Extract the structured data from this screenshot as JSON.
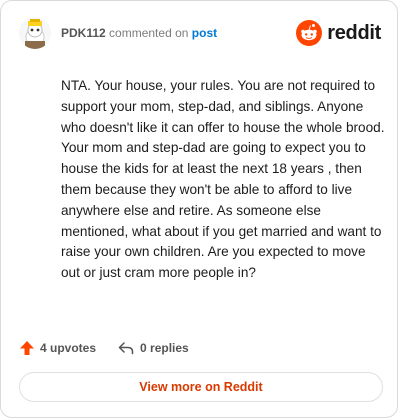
{
  "header": {
    "username": "PDK112",
    "action_text": "commented on",
    "post_link": "post",
    "brand_wordmark": "reddit",
    "avatar_icon": "avatar-icon",
    "logo_icon": "reddit-alien-icon"
  },
  "comment": {
    "text": "NTA. Your house, your rules. You are not required to support your mom, step-dad, and siblings. Anyone who doesn't like it can offer to house the whole brood. Your mom and step-dad are going to expect you to house the kids for at least the next 18 years , then them because they won't be able to afford to live anywhere else and retire. As someone else mentioned, what about if you get married and want to raise your own children. Are you expected to move out or just cram more people in?"
  },
  "footer": {
    "upvotes_label": "4 upvotes",
    "replies_label": "0 replies",
    "upvote_icon": "upvote-arrow-icon",
    "reply_icon": "reply-icon"
  },
  "cta": {
    "view_more_label": "View more on Reddit"
  },
  "colors": {
    "brand_orange": "#ff4500",
    "link_blue": "#0079d3",
    "cta_text": "#d93a00"
  }
}
